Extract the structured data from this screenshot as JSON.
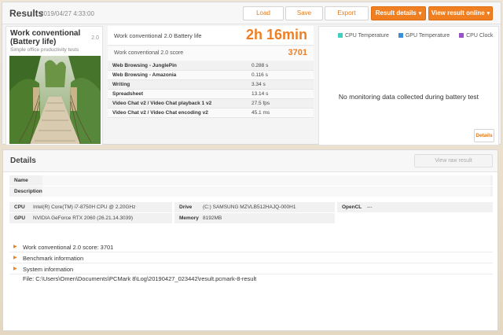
{
  "header": {
    "title": "Results",
    "date": "2019/04/27 4:33:00",
    "buttons": {
      "load": "Load",
      "save": "Save",
      "export": "Export",
      "result_details": "Result details",
      "view_online": "View result online"
    }
  },
  "benchmark": {
    "name": "Work conventional (Battery life)",
    "version": "2.0",
    "description": "Simple office productivity tests"
  },
  "scores": {
    "main_label": "Work conventional 2.0 Battery life",
    "main_value": "2h 16min",
    "sub_label": "Work conventional 2.0 score",
    "sub_value": "3701",
    "subtests": [
      {
        "name": "Web Browsing - JunglePin",
        "value": "0.288 s"
      },
      {
        "name": "Web Browsing - Amazonia",
        "value": "0.116 s"
      },
      {
        "name": "Writing",
        "value": "3.34 s"
      },
      {
        "name": "Spreadsheet",
        "value": "13.14 s"
      },
      {
        "name": "Video Chat v2 / Video Chat playback 1 v2",
        "value": "27.5 fps"
      },
      {
        "name": "Video Chat v2 / Video Chat encoding v2",
        "value": "45.1 ms"
      }
    ]
  },
  "monitoring": {
    "legend": [
      {
        "label": "CPU Temperature",
        "color": "#3fd0c0"
      },
      {
        "label": "GPU Temperature",
        "color": "#3a8fd8"
      },
      {
        "label": "CPU Clock",
        "color": "#9b4fc8"
      }
    ],
    "no_data": "No monitoring data collected during battery test",
    "details_button": "Details"
  },
  "details": {
    "title": "Details",
    "view_raw_button": "View raw result",
    "name_label": "Name",
    "description_label": "Description",
    "cpu_label": "CPU",
    "cpu_value": "Intel(R) Core(TM) i7-8750H CPU @ 2.20GHz",
    "gpu_label": "GPU",
    "gpu_value": "NVIDIA GeForce RTX 2060 (26.21.14.3039)",
    "drive_label": "Drive",
    "drive_value": "(C:) SAMSUNG MZVLB512HAJQ-000H1",
    "memory_label": "Memory",
    "memory_value": "8192MB",
    "opencl_label": "OpenCL",
    "opencl_value": "---",
    "sections": [
      "Work conventional 2.0 score: 3701",
      "Benchmark information",
      "System information"
    ],
    "file_path": "File: C:\\Users\\Omen\\Documents\\PCMark 8\\Log\\20190427_023442\\result.pcmark-8-result"
  },
  "colors": {
    "accent": "#f07f21"
  }
}
